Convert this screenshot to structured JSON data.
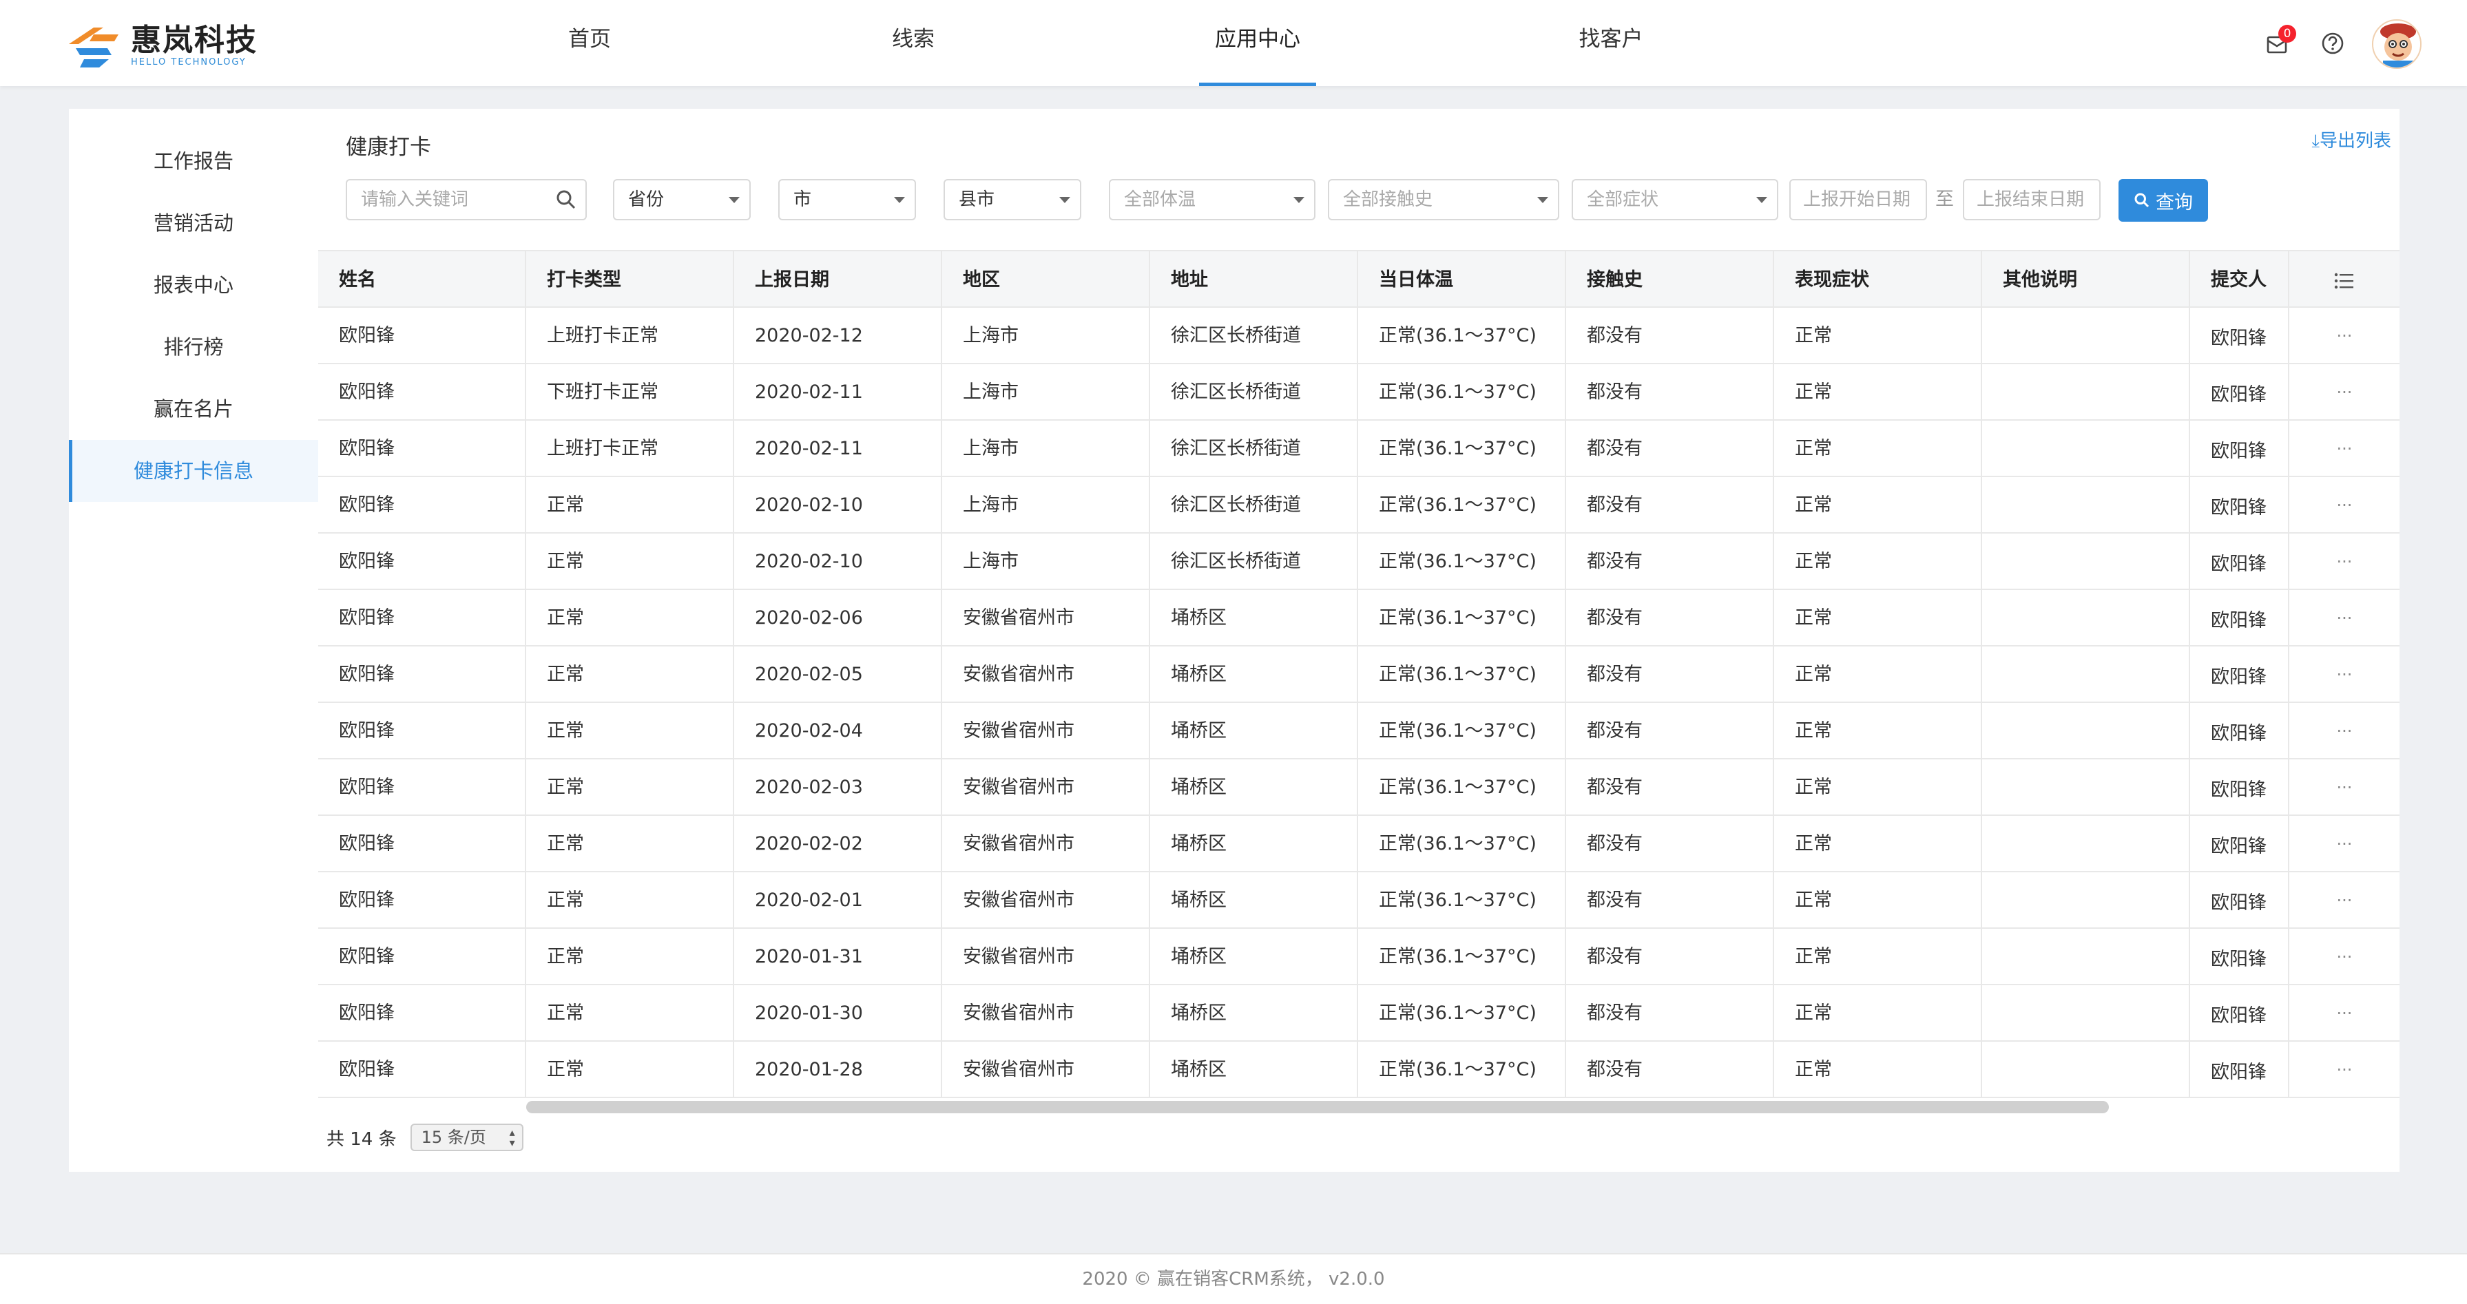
{
  "brand": {
    "name_cn": "惠岚科技",
    "name_en": "HELLO TECHNOLOGY",
    "accent": "#2f8bdc"
  },
  "nav": {
    "items": [
      {
        "label": "首页",
        "active": false
      },
      {
        "label": "线索",
        "active": false
      },
      {
        "label": "应用中心",
        "active": true
      },
      {
        "label": "找客户",
        "active": false
      }
    ],
    "notification_count": "0",
    "icons": [
      "bell-icon",
      "help-icon",
      "avatar"
    ]
  },
  "sidebar": {
    "items": [
      {
        "label": "工作报告",
        "active": false
      },
      {
        "label": "营销活动",
        "active": false
      },
      {
        "label": "报表中心",
        "active": false
      },
      {
        "label": "排行榜",
        "active": false
      },
      {
        "label": "赢在名片",
        "active": false
      },
      {
        "label": "健康打卡信息",
        "active": true
      }
    ]
  },
  "page": {
    "title": "健康打卡",
    "export_label": "导出列表"
  },
  "filters": {
    "keyword_placeholder": "请输入关键词",
    "province": "省份",
    "city": "市",
    "county": "县市",
    "temperature": "全部体温",
    "contact": "全部接触史",
    "symptom": "全部症状",
    "start_date_placeholder": "上报开始日期",
    "range_separator": "至",
    "end_date_placeholder": "上报结束日期",
    "query_label": "查询"
  },
  "table": {
    "columns": [
      "姓名",
      "打卡类型",
      "上报日期",
      "地区",
      "地址",
      "当日体温",
      "接触史",
      "表现症状",
      "其他说明",
      "提交人"
    ],
    "rows": [
      {
        "name": "欧阳锋",
        "type": "上班打卡正常",
        "date": "2020-02-12",
        "region": "上海市",
        "address": "徐汇区长桥街道",
        "temp": "正常(36.1～37°C)",
        "contact": "都没有",
        "symptom": "正常",
        "note": "",
        "submitter": "欧阳锋"
      },
      {
        "name": "欧阳锋",
        "type": "下班打卡正常",
        "date": "2020-02-11",
        "region": "上海市",
        "address": "徐汇区长桥街道",
        "temp": "正常(36.1～37°C)",
        "contact": "都没有",
        "symptom": "正常",
        "note": "",
        "submitter": "欧阳锋"
      },
      {
        "name": "欧阳锋",
        "type": "上班打卡正常",
        "date": "2020-02-11",
        "region": "上海市",
        "address": "徐汇区长桥街道",
        "temp": "正常(36.1～37°C)",
        "contact": "都没有",
        "symptom": "正常",
        "note": "",
        "submitter": "欧阳锋"
      },
      {
        "name": "欧阳锋",
        "type": "正常",
        "date": "2020-02-10",
        "region": "上海市",
        "address": "徐汇区长桥街道",
        "temp": "正常(36.1～37°C)",
        "contact": "都没有",
        "symptom": "正常",
        "note": "",
        "submitter": "欧阳锋"
      },
      {
        "name": "欧阳锋",
        "type": "正常",
        "date": "2020-02-10",
        "region": "上海市",
        "address": "徐汇区长桥街道",
        "temp": "正常(36.1～37°C)",
        "contact": "都没有",
        "symptom": "正常",
        "note": "",
        "submitter": "欧阳锋"
      },
      {
        "name": "欧阳锋",
        "type": "正常",
        "date": "2020-02-06",
        "region": "安徽省宿州市",
        "address": "埇桥区",
        "temp": "正常(36.1～37°C)",
        "contact": "都没有",
        "symptom": "正常",
        "note": "",
        "submitter": "欧阳锋"
      },
      {
        "name": "欧阳锋",
        "type": "正常",
        "date": "2020-02-05",
        "region": "安徽省宿州市",
        "address": "埇桥区",
        "temp": "正常(36.1～37°C)",
        "contact": "都没有",
        "symptom": "正常",
        "note": "",
        "submitter": "欧阳锋"
      },
      {
        "name": "欧阳锋",
        "type": "正常",
        "date": "2020-02-04",
        "region": "安徽省宿州市",
        "address": "埇桥区",
        "temp": "正常(36.1～37°C)",
        "contact": "都没有",
        "symptom": "正常",
        "note": "",
        "submitter": "欧阳锋"
      },
      {
        "name": "欧阳锋",
        "type": "正常",
        "date": "2020-02-03",
        "region": "安徽省宿州市",
        "address": "埇桥区",
        "temp": "正常(36.1～37°C)",
        "contact": "都没有",
        "symptom": "正常",
        "note": "",
        "submitter": "欧阳锋"
      },
      {
        "name": "欧阳锋",
        "type": "正常",
        "date": "2020-02-02",
        "region": "安徽省宿州市",
        "address": "埇桥区",
        "temp": "正常(36.1～37°C)",
        "contact": "都没有",
        "symptom": "正常",
        "note": "",
        "submitter": "欧阳锋"
      },
      {
        "name": "欧阳锋",
        "type": "正常",
        "date": "2020-02-01",
        "region": "安徽省宿州市",
        "address": "埇桥区",
        "temp": "正常(36.1～37°C)",
        "contact": "都没有",
        "symptom": "正常",
        "note": "",
        "submitter": "欧阳锋"
      },
      {
        "name": "欧阳锋",
        "type": "正常",
        "date": "2020-01-31",
        "region": "安徽省宿州市",
        "address": "埇桥区",
        "temp": "正常(36.1～37°C)",
        "contact": "都没有",
        "symptom": "正常",
        "note": "",
        "submitter": "欧阳锋"
      },
      {
        "name": "欧阳锋",
        "type": "正常",
        "date": "2020-01-30",
        "region": "安徽省宿州市",
        "address": "埇桥区",
        "temp": "正常(36.1～37°C)",
        "contact": "都没有",
        "symptom": "正常",
        "note": "",
        "submitter": "欧阳锋"
      },
      {
        "name": "欧阳锋",
        "type": "正常",
        "date": "2020-01-28",
        "region": "安徽省宿州市",
        "address": "埇桥区",
        "temp": "正常(36.1～37°C)",
        "contact": "都没有",
        "symptom": "正常",
        "note": "",
        "submitter": "欧阳锋"
      }
    ],
    "row_action": "···"
  },
  "pagination": {
    "total_label": "共 14 条",
    "page_size": "15 条/页"
  },
  "footer": {
    "text": "2020 © 赢在销客CRM系统， v2.0.0"
  }
}
